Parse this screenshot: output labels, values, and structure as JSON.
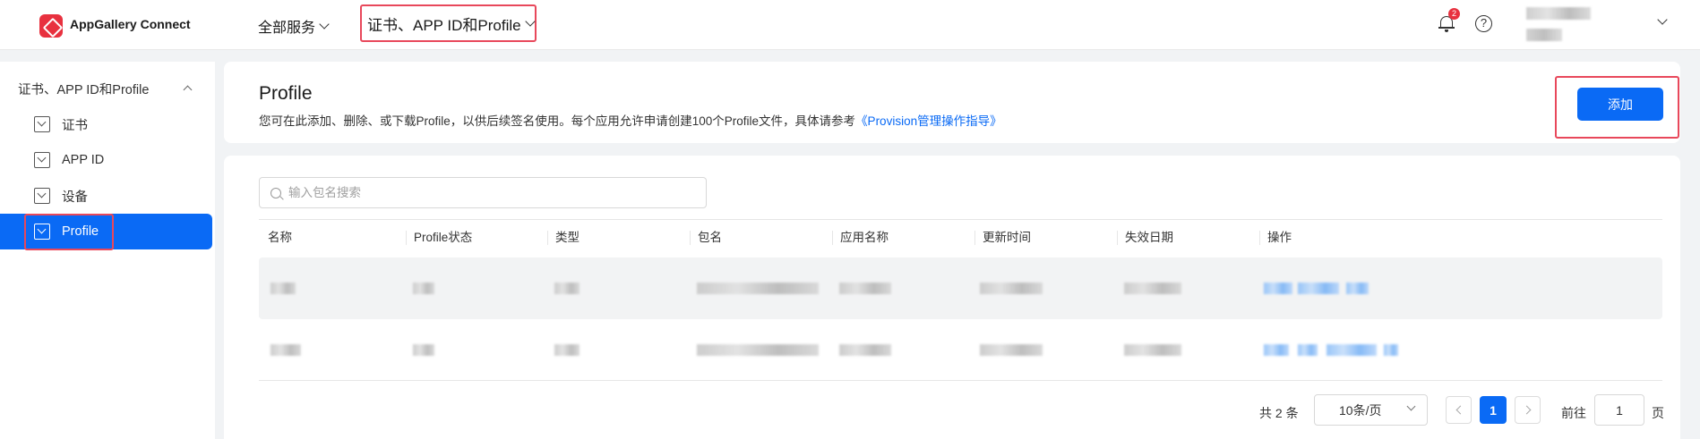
{
  "topbar": {
    "brand": "AppGallery Connect",
    "nav_all": "全部服务",
    "nav_cert": "证书、APP ID和Profile",
    "notif_count": "2",
    "help": "?"
  },
  "sidebar": {
    "group": "证书、APP ID和Profile",
    "items": [
      {
        "label": "证书"
      },
      {
        "label": "APP ID"
      },
      {
        "label": "设备"
      },
      {
        "label": "Profile"
      }
    ]
  },
  "header": {
    "title": "Profile",
    "desc": "您可在此添加、删除、或下载Profile，以供后续签名使用。每个应用允许申请创建100个Profile文件，具体请参考",
    "link": "《Provision管理操作指导》",
    "add_label": "添加"
  },
  "search": {
    "placeholder": "输入包名搜索"
  },
  "table": {
    "columns": [
      "名称",
      "Profile状态",
      "类型",
      "包名",
      "应用名称",
      "更新时间",
      "失效日期",
      "操作"
    ]
  },
  "pagination": {
    "total": "共 2 条",
    "page_size": "10条/页",
    "current": "1",
    "goto_label": "前往",
    "goto_value": "1",
    "page_unit": "页"
  },
  "colors": {
    "accent": "#0a6af5",
    "highlight": "#e8485b",
    "brand": "#e8313f"
  }
}
